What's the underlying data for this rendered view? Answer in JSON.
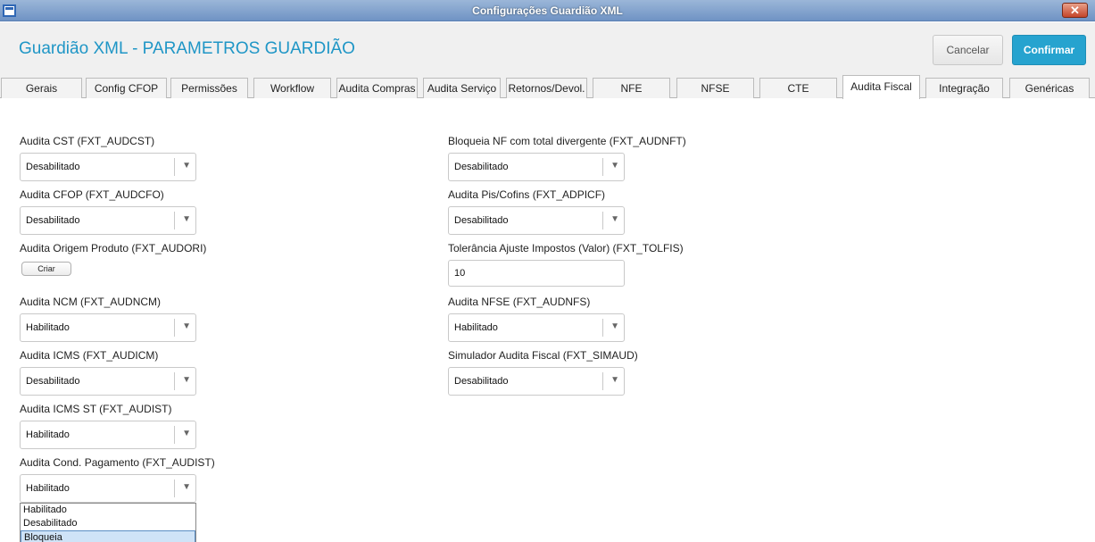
{
  "window": {
    "title": "Configurações Guardião XML",
    "close_glyph": "✕"
  },
  "header": {
    "title": "Guardião XML - PARAMETROS GUARDIÃO",
    "cancel_label": "Cancelar",
    "confirm_label": "Confirmar"
  },
  "tabs": [
    {
      "label": "Gerais"
    },
    {
      "label": "Config CFOP"
    },
    {
      "label": "Permissões"
    },
    {
      "label": "Workflow"
    },
    {
      "label": "Audita Compras"
    },
    {
      "label": "Audita Serviço"
    },
    {
      "label": "Retornos/Devol."
    },
    {
      "label": "NFE"
    },
    {
      "label": "NFSE"
    },
    {
      "label": "CTE"
    },
    {
      "label": "Audita Fiscal",
      "active": true
    },
    {
      "label": "Integração"
    },
    {
      "label": "Genéricas"
    }
  ],
  "left_fields": {
    "audcst": {
      "label": "Audita CST (FXT_AUDCST)",
      "value": "Desabilitado"
    },
    "audcfo": {
      "label": "Audita CFOP (FXT_AUDCFO)",
      "value": "Desabilitado"
    },
    "audori": {
      "label": "Audita Origem Produto (FXT_AUDORI)",
      "button_label": "Criar"
    },
    "audncm": {
      "label": "Audita NCM (FXT_AUDNCM)",
      "value": "Habilitado"
    },
    "audicm": {
      "label": "Audita ICMS (FXT_AUDICM)",
      "value": "Desabilitado"
    },
    "audist": {
      "label": "Audita ICMS ST (FXT_AUDIST)",
      "value": "Habilitado"
    },
    "audcond": {
      "label": "Audita Cond. Pagamento (FXT_AUDIST)",
      "value": "Habilitado"
    }
  },
  "right_fields": {
    "audnft": {
      "label": "Bloqueia NF com total divergente (FXT_AUDNFT)",
      "value": "Desabilitado"
    },
    "adpicf": {
      "label": "Audita Pis/Cofins (FXT_ADPICF)",
      "value": "Desabilitado"
    },
    "tolfis": {
      "label": "Tolerância Ajuste Impostos (Valor) (FXT_TOLFIS)",
      "value": "10"
    },
    "audnfs": {
      "label": "Audita NFSE (FXT_AUDNFS)",
      "value": "Habilitado"
    },
    "simaud": {
      "label": "Simulador Audita Fiscal (FXT_SIMAUD)",
      "value": "Desabilitado"
    }
  },
  "dropdown_options": [
    "Habilitado",
    "Desabilitado",
    "Bloqueia"
  ],
  "dropdown_highlighted": "Bloqueia",
  "icons": {
    "select_arrow": "▼"
  },
  "colors": {
    "accent": "#26a3cf",
    "title_text": "#1f96c6",
    "titlebar": "#6f93c4"
  }
}
